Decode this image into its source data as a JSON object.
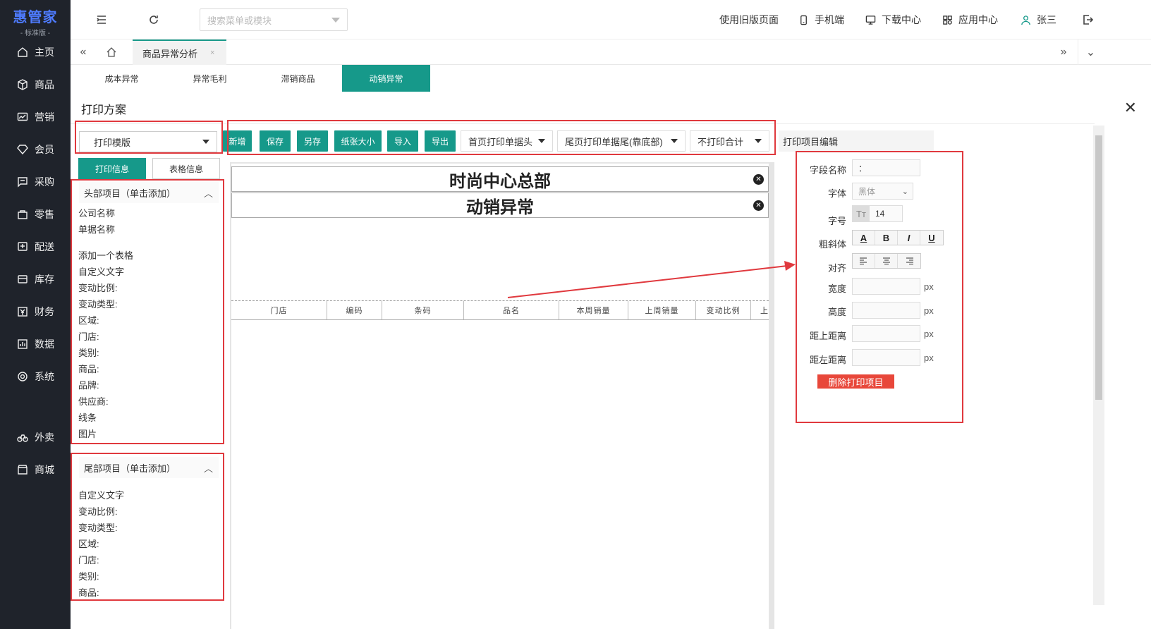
{
  "logo": {
    "name": "惠管家",
    "edition": "- 标准版 -"
  },
  "sidebar": {
    "items": [
      {
        "label": "主页",
        "icon": "home-icon"
      },
      {
        "label": "商品",
        "icon": "box-icon"
      },
      {
        "label": "营销",
        "icon": "chart-icon"
      },
      {
        "label": "会员",
        "icon": "diamond-icon"
      },
      {
        "label": "采购",
        "icon": "cart-icon"
      },
      {
        "label": "零售",
        "icon": "bag-icon"
      },
      {
        "label": "配送",
        "icon": "truck-icon"
      },
      {
        "label": "库存",
        "icon": "inbox-icon"
      },
      {
        "label": "财务",
        "icon": "yen-icon"
      },
      {
        "label": "数据",
        "icon": "bar-chart-icon"
      },
      {
        "label": "系统",
        "icon": "settings-icon"
      },
      {
        "label": "外卖",
        "icon": "bike-icon"
      },
      {
        "label": "商城",
        "icon": "store-icon"
      }
    ]
  },
  "topbar": {
    "search_placeholder": "搜索菜单或模块",
    "links": [
      "使用旧版页面",
      "手机端",
      "下载中心",
      "应用中心",
      "张三"
    ]
  },
  "tabs": {
    "page_tab": "商品异常分析",
    "close": "×"
  },
  "subtabs": [
    "成本异常",
    "异常毛利",
    "滞销商品",
    "动销异常"
  ],
  "dialog": {
    "title": "打印方案",
    "template_select": "打印模版",
    "toolbar": [
      "新增",
      "保存",
      "另存",
      "纸张大小",
      "导入",
      "导出"
    ],
    "dropdowns": [
      "首页打印单据头",
      "尾页打印单据尾(靠底部)",
      "不打印合计"
    ],
    "left_tabs": [
      "打印信息",
      "表格信息"
    ],
    "header_section": "头部项目（单击添加）",
    "header_items": [
      "公司名称",
      "单据名称",
      "添加一个表格",
      "自定义文字",
      "变动比例:",
      "变动类型:",
      "区域:",
      "门店:",
      "类别:",
      "商品:",
      "品牌:",
      "供应商:",
      "线条",
      "图片"
    ],
    "footer_section": "尾部项目（单击添加）",
    "footer_items": [
      "自定义文字",
      "变动比例:",
      "变动类型:",
      "区域:",
      "门店:",
      "类别:",
      "商品:"
    ],
    "canvas_header1": "时尚中心总部",
    "canvas_header2": "动销异常",
    "table_columns": [
      "门店",
      "编码",
      "条码",
      "品名",
      "本周销量",
      "上周销量",
      "变动比例",
      "上"
    ],
    "editor": {
      "head": "打印项目编辑",
      "field_name_label": "字段名称",
      "field_name_value": "：",
      "font_label": "字体",
      "font_value": "黑体",
      "size_label": "字号",
      "size_value": "14",
      "size_icon": "Tт",
      "style_label": "粗斜体",
      "style_buttons": [
        "A",
        "B",
        "I",
        "U"
      ],
      "align_label": "对齐",
      "width_label": "宽度",
      "height_label": "高度",
      "top_label": "距上距离",
      "left_label": "距左距离",
      "unit": "px",
      "delete_button": "删除打印项目"
    }
  }
}
